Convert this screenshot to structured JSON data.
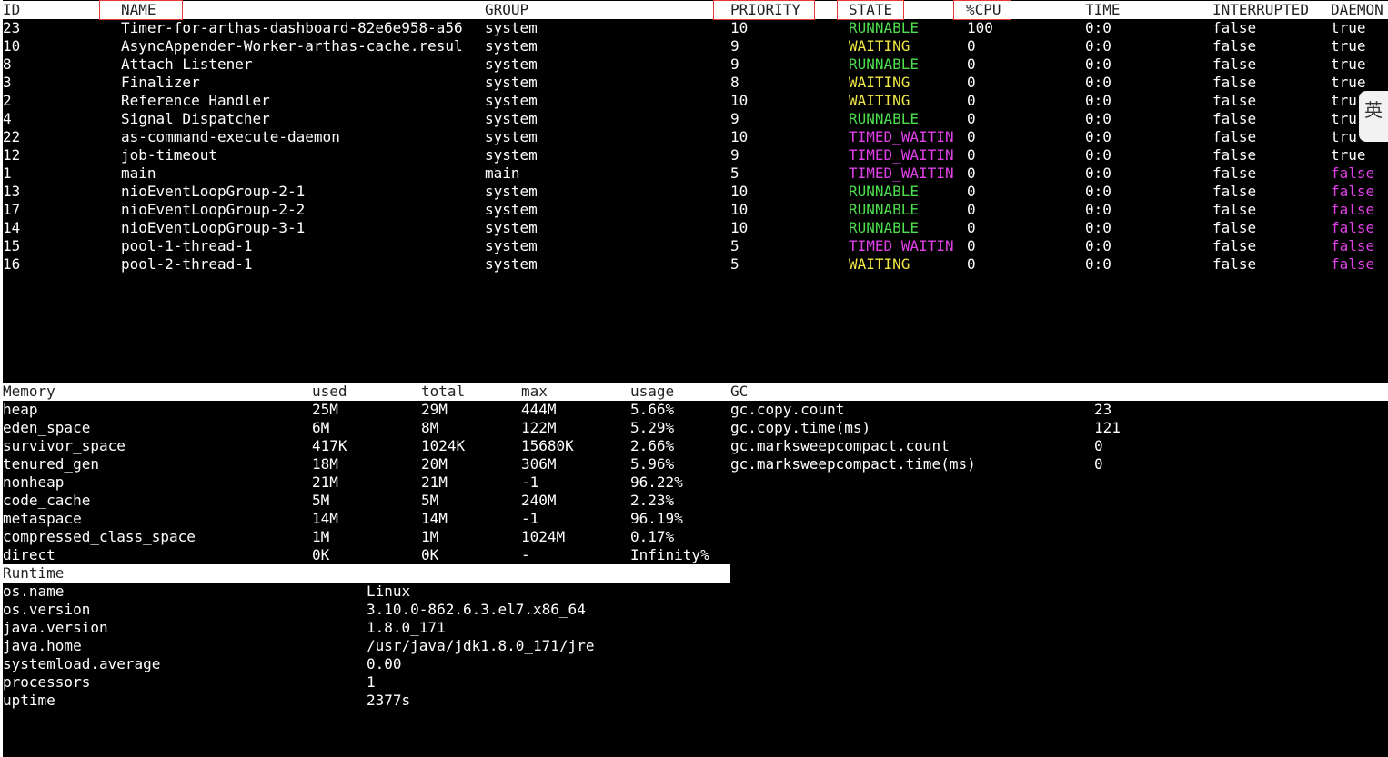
{
  "threads": {
    "headers": [
      "ID",
      "NAME",
      "GROUP",
      "PRIORITY",
      "STATE",
      "%CPU",
      "TIME",
      "INTERRUPTED",
      "DAEMON"
    ],
    "rows": [
      {
        "id": "23",
        "name": "Timer-for-arthas-dashboard-82e6e958-a56",
        "group": "system",
        "priority": "10",
        "state": "RUNNABLE",
        "cpu": "100",
        "time": "0:0",
        "interrupted": "false",
        "daemon": "true"
      },
      {
        "id": "10",
        "name": "AsyncAppender-Worker-arthas-cache.resul",
        "group": "system",
        "priority": "9",
        "state": "WAITING",
        "cpu": "0",
        "time": "0:0",
        "interrupted": "false",
        "daemon": "true"
      },
      {
        "id": "8",
        "name": "Attach Listener",
        "group": "system",
        "priority": "9",
        "state": "RUNNABLE",
        "cpu": "0",
        "time": "0:0",
        "interrupted": "false",
        "daemon": "true"
      },
      {
        "id": "3",
        "name": "Finalizer",
        "group": "system",
        "priority": "8",
        "state": "WAITING",
        "cpu": "0",
        "time": "0:0",
        "interrupted": "false",
        "daemon": "true"
      },
      {
        "id": "2",
        "name": "Reference Handler",
        "group": "system",
        "priority": "10",
        "state": "WAITING",
        "cpu": "0",
        "time": "0:0",
        "interrupted": "false",
        "daemon": "tru"
      },
      {
        "id": "4",
        "name": "Signal Dispatcher",
        "group": "system",
        "priority": "9",
        "state": "RUNNABLE",
        "cpu": "0",
        "time": "0:0",
        "interrupted": "false",
        "daemon": "tru"
      },
      {
        "id": "22",
        "name": "as-command-execute-daemon",
        "group": "system",
        "priority": "10",
        "state": "TIMED_WAITIN",
        "cpu": "0",
        "time": "0:0",
        "interrupted": "false",
        "daemon": "tru"
      },
      {
        "id": "12",
        "name": "job-timeout",
        "group": "system",
        "priority": "9",
        "state": "TIMED_WAITIN",
        "cpu": "0",
        "time": "0:0",
        "interrupted": "false",
        "daemon": "true"
      },
      {
        "id": "1",
        "name": "main",
        "group": "main",
        "priority": "5",
        "state": "TIMED_WAITIN",
        "cpu": "0",
        "time": "0:0",
        "interrupted": "false",
        "daemon": "false"
      },
      {
        "id": "13",
        "name": "nioEventLoopGroup-2-1",
        "group": "system",
        "priority": "10",
        "state": "RUNNABLE",
        "cpu": "0",
        "time": "0:0",
        "interrupted": "false",
        "daemon": "false"
      },
      {
        "id": "17",
        "name": "nioEventLoopGroup-2-2",
        "group": "system",
        "priority": "10",
        "state": "RUNNABLE",
        "cpu": "0",
        "time": "0:0",
        "interrupted": "false",
        "daemon": "false"
      },
      {
        "id": "14",
        "name": "nioEventLoopGroup-3-1",
        "group": "system",
        "priority": "10",
        "state": "RUNNABLE",
        "cpu": "0",
        "time": "0:0",
        "interrupted": "false",
        "daemon": "false"
      },
      {
        "id": "15",
        "name": "pool-1-thread-1",
        "group": "system",
        "priority": "5",
        "state": "TIMED_WAITIN",
        "cpu": "0",
        "time": "0:0",
        "interrupted": "false",
        "daemon": "false"
      },
      {
        "id": "16",
        "name": "pool-2-thread-1",
        "group": "system",
        "priority": "5",
        "state": "WAITING",
        "cpu": "0",
        "time": "0:0",
        "interrupted": "false",
        "daemon": "false"
      }
    ]
  },
  "memory": {
    "headers": [
      "Memory",
      "used",
      "total",
      "max",
      "usage"
    ],
    "rows": [
      {
        "name": "heap",
        "used": "25M",
        "total": "29M",
        "max": "444M",
        "usage": "5.66%"
      },
      {
        "name": "eden_space",
        "used": "6M",
        "total": "8M",
        "max": "122M",
        "usage": "5.29%"
      },
      {
        "name": "survivor_space",
        "used": "417K",
        "total": "1024K",
        "max": "15680K",
        "usage": "2.66%"
      },
      {
        "name": "tenured_gen",
        "used": "18M",
        "total": "20M",
        "max": "306M",
        "usage": "5.96%"
      },
      {
        "name": "nonheap",
        "used": "21M",
        "total": "21M",
        "max": "-1",
        "usage": "96.22%"
      },
      {
        "name": "code_cache",
        "used": "5M",
        "total": "5M",
        "max": "240M",
        "usage": "2.23%"
      },
      {
        "name": "metaspace",
        "used": "14M",
        "total": "14M",
        "max": "-1",
        "usage": "96.19%"
      },
      {
        "name": "compressed_class_space",
        "used": "1M",
        "total": "1M",
        "max": "1024M",
        "usage": "0.17%"
      },
      {
        "name": "direct",
        "used": "0K",
        "total": "0K",
        "max": "-",
        "usage": "Infinity%"
      }
    ]
  },
  "gc": {
    "header": "GC",
    "rows": [
      {
        "name": "gc.copy.count",
        "value": "23"
      },
      {
        "name": "gc.copy.time(ms)",
        "value": "121"
      },
      {
        "name": "gc.marksweepcompact.count",
        "value": "0"
      },
      {
        "name": "gc.marksweepcompact.time(ms)",
        "value": "0"
      }
    ]
  },
  "runtime": {
    "header": "Runtime",
    "rows": [
      {
        "name": "os.name",
        "value": "Linux"
      },
      {
        "name": "os.version",
        "value": "3.10.0-862.6.3.el7.x86_64"
      },
      {
        "name": "java.version",
        "value": "1.8.0_171"
      },
      {
        "name": "java.home",
        "value": "/usr/java/jdk1.8.0_171/jre"
      },
      {
        "name": "systemload.average",
        "value": "0.00"
      },
      {
        "name": "processors",
        "value": "1"
      },
      {
        "name": "uptime",
        "value": "2377s"
      }
    ]
  },
  "ime_indicator": "英",
  "colors": {
    "background": "#000000",
    "text": "#ffffff",
    "header_bg": "#ffffff",
    "header_text": "#222222",
    "runnable": "#4cde4c",
    "waiting": "#f0e845",
    "timed_waiting": "#e040e8",
    "daemon_false": "#e040e8",
    "annotation_box": "#e53935"
  }
}
